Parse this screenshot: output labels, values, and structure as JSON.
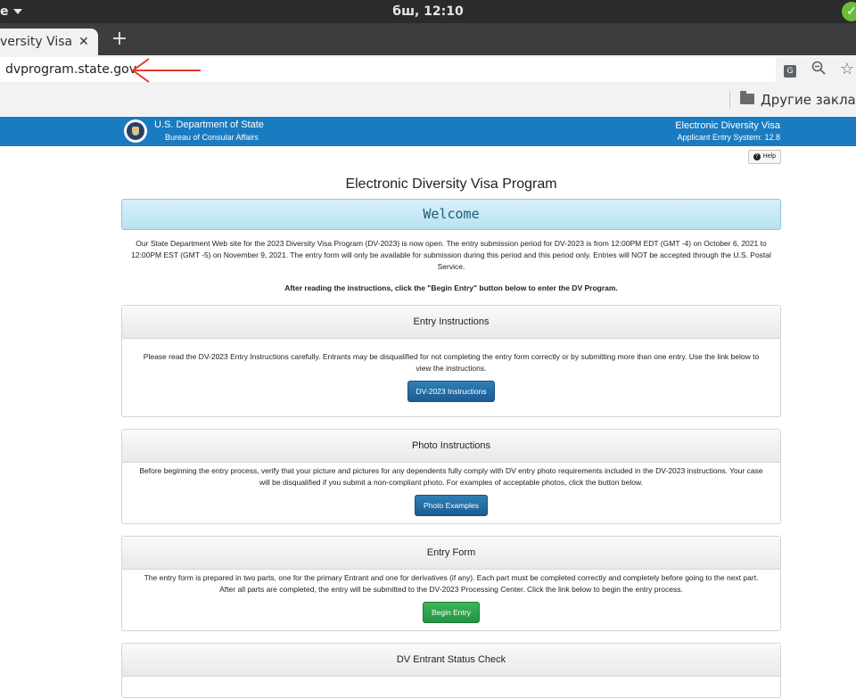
{
  "os": {
    "app_name": "e",
    "clock": "бш, 12:10"
  },
  "browser": {
    "tab_title": "versity Visa P",
    "tab_close": "✕",
    "new_tab": "+",
    "url": "dvprogram.state.gov",
    "bookmark_folder": "Другие заклад"
  },
  "header": {
    "department": "U.S. Department of State",
    "bureau": "Bureau of Consular Affairs",
    "system_name": "Electronic Diversity Visa",
    "system_version": "Applicant Entry System: 12.8"
  },
  "page": {
    "help_label": "Help",
    "title": "Electronic Diversity Visa Program",
    "welcome": "Welcome",
    "intro": "Our State Department Web site for the 2023 Diversity Visa Program (DV-2023) is now open. The entry submission period for DV-2023 is from 12:00PM EDT (GMT -4) on October 6, 2021 to 12:00PM EST (GMT -5) on November 9, 2021. The entry form will only be available for submission during this period and this period only. Entries will NOT be accepted through the U.S. Postal Service.",
    "instruction": "After reading the instructions, click the \"Begin Entry\" button below to enter the DV Program."
  },
  "panels": [
    {
      "title": "Entry Instructions",
      "body": "Please read the DV-2023 Entry Instructions carefully. Entrants may be disqualified for not completing the entry form correctly or by submitting more than one entry. Use the link below to view the instructions.",
      "button": "DV-2023 Instructions"
    },
    {
      "title": "Photo Instructions",
      "body": "Before beginning the entry process, verify that your picture and pictures for any dependents fully comply with DV entry photo requirements included in the DV-2023 instructions.  Your case will be disqualified if you submit a non-compliant photo.  For examples of acceptable photos, click the button below.",
      "button": "Photo Examples"
    },
    {
      "title": "Entry Form",
      "body": "The entry form is prepared in two parts, one for the primary Entrant and one for derivatives (if any). Each part must be completed correctly and completely before going to the next part. After all parts are completed, the entry will be submitted to the DV-2023 Processing Center. Click the link below to begin the entry process.",
      "button": "Begin Entry"
    },
    {
      "title": "DV Entrant Status Check"
    }
  ],
  "colors": {
    "header_blue": "#1a7bc0",
    "welcome_bg": "#c8e9f6",
    "button_blue": "#1c5d92",
    "button_green": "#23933f",
    "annotation_arrow": "#e53b2c"
  }
}
